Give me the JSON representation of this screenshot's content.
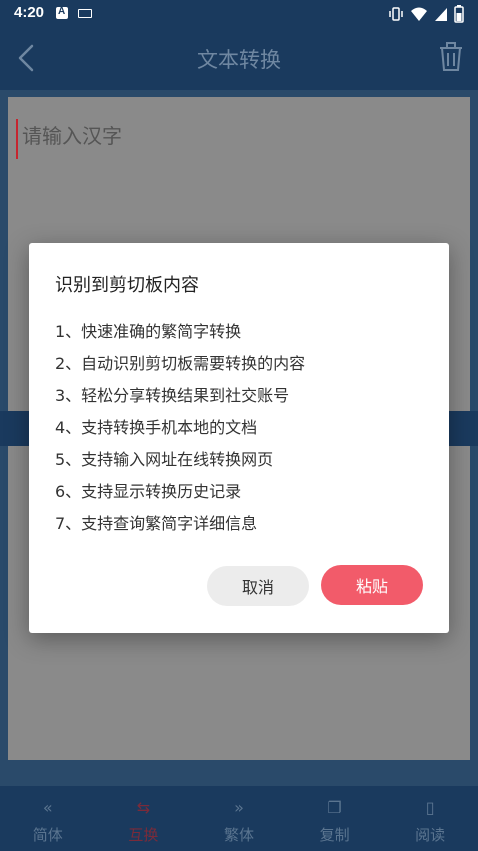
{
  "status_bar": {
    "time": "4:20",
    "icons": [
      "app-a-icon",
      "keyboard-icon",
      "vibrate-icon",
      "wifi-icon",
      "signal-icon",
      "battery-icon"
    ]
  },
  "header": {
    "title": "文本转换",
    "back_icon": "chevron-left-icon",
    "trash_icon": "trash-icon"
  },
  "input": {
    "placeholder": "请输入汉字"
  },
  "dialog": {
    "title": "识别到剪切板内容",
    "items": [
      "1、快速准确的繁简字转换",
      "2、自动识别剪切板需要转换的内容",
      "3、轻松分享转换结果到社交账号",
      "4、支持转换手机本地的文档",
      "5、支持输入网址在线转换网页",
      "6、支持显示转换历史记录",
      "7、支持查询繁简字详细信息"
    ],
    "cancel_label": "取消",
    "paste_label": "粘贴"
  },
  "bottom_nav": {
    "items": [
      {
        "label": "简体",
        "icon": "double-chevron-left-icon",
        "glyph": "«"
      },
      {
        "label": "互换",
        "icon": "swap-icon",
        "glyph": "⇆"
      },
      {
        "label": "繁体",
        "icon": "double-chevron-right-icon",
        "glyph": "»"
      },
      {
        "label": "复制",
        "icon": "copy-icon",
        "glyph": "❐"
      },
      {
        "label": "阅读",
        "icon": "book-icon",
        "glyph": "▯"
      }
    ]
  },
  "colors": {
    "primary": "#1a3a5e",
    "accent": "#f25b6a",
    "cursor": "#c6252f"
  }
}
